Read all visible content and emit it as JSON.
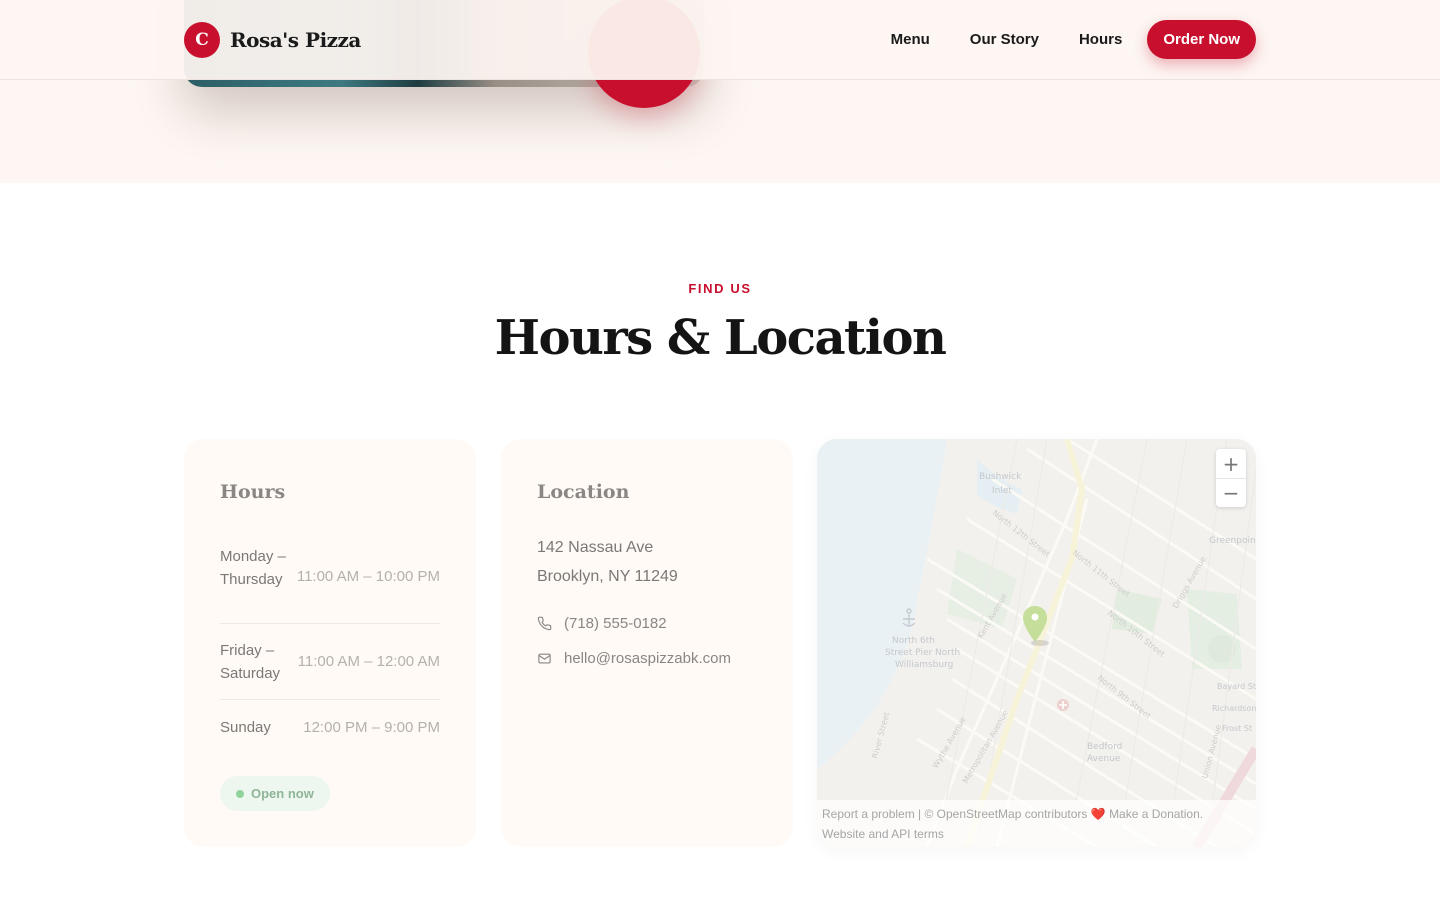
{
  "brand": {
    "logo_letter": "C",
    "name": "Rosa's Pizza"
  },
  "nav": {
    "items": [
      "Menu",
      "Our Story",
      "Hours"
    ],
    "cta": "Order Now"
  },
  "section": {
    "eyebrow": "FIND US",
    "title": "Hours & Location"
  },
  "hours_card": {
    "title": "Hours",
    "rows": [
      {
        "day": "Monday – Thursday",
        "time": "11:00 AM – 10:00 PM"
      },
      {
        "day": "Friday – Saturday",
        "time": "11:00 AM – 12:00 AM"
      },
      {
        "day": "Sunday",
        "time": "12:00 PM – 9:00 PM"
      }
    ],
    "status": "Open now"
  },
  "location_card": {
    "title": "Location",
    "address_line1": "142 Nassau Ave",
    "address_line2": "Brooklyn, NY 11249",
    "phone": "(718) 555-0182",
    "email": "hello@rosaspizzabk.com"
  },
  "map": {
    "zoom_in": "+",
    "zoom_out": "−",
    "attribution_line1_a": "Report a problem | © OpenStreetMap contributors",
    "attribution_heart": "❤️",
    "attribution_line1_b": "Make a Donation.",
    "attribution_line2": "Website and API terms",
    "labels": [
      "Bushwick Inlet",
      "Greenpoin",
      "North 12th Street",
      "North 11th Street",
      "North 10th Street",
      "North 9th Street",
      "Kent Avenue",
      "Wythe Avenue",
      "Bedford Avenue",
      "Union Avenue",
      "Bayard St",
      "Richardson",
      "Frost St",
      "North 6th Street Pier North Williamsburg",
      "Metropolitan Avenue",
      "Driggs Avenue",
      "River Street"
    ],
    "icons": [
      "marker-pin",
      "anchor",
      "hospital"
    ]
  },
  "colors": {
    "brand_red": "#c8102e",
    "cream": "#fdf6f2",
    "card_bg": "#fffaf6",
    "open_green": "#8fd39a"
  }
}
